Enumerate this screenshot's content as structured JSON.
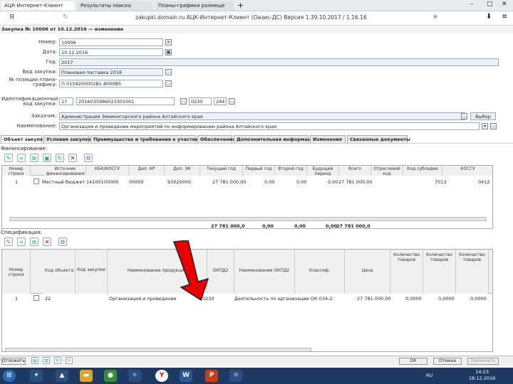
{
  "browser": {
    "tabs": [
      {
        "label": "АЦК-Интернет-Клиент"
      },
      {
        "label": "Результаты поиска"
      },
      {
        "label": "Планы-графики размеще"
      }
    ],
    "logo": "Я",
    "address": "zakupki.domain.ru  АЦК-Интернет-Клиент (Оазис-ДС) Версия 1.39.10.2017 / 1.16.16",
    "newtab": "+"
  },
  "page": {
    "header": "Закупка № 10006 от 10.12.2016 — изменение"
  },
  "form": {
    "number_label": "Номер:",
    "number": "10006",
    "date_label": "Дата:",
    "date": "10.12.2016",
    "year_label": "Год:",
    "year": "2017",
    "plan_label": "Вид закупки:",
    "plan": "Плановая поставка 2018",
    "pos_label": "№ позиции плана-графика:",
    "pos": "П.0159200002В1.8000В5",
    "ident_label": "Идентификационный код закупки:",
    "ident_a": "17",
    "ident_b": "2016035986023301001",
    "ident_c": "0230",
    "ident_d": "244",
    "customer_label": "Заказчик:",
    "customer": "Администрация Змеиногорского района Алтайского края",
    "choose": "Выбор",
    "name_label": "Наименование:",
    "name": "Организация и проведение мероприятий по информированию района Алтайского края"
  },
  "tabs": [
    "Объект закупки",
    "Условия закупки",
    "Преимущества и требования к участнику",
    "Обеспечение",
    "Дополнительная информация",
    "Изменения",
    "Связанные документы"
  ],
  "finance": {
    "title": "Финансирование:",
    "cols": [
      "Номер строки",
      "Источник финансирования",
      "КБК/КОСГУ",
      "Доп. КР",
      "Доп. ЭК",
      "Текущий год",
      "Первый год",
      "Второй год",
      "Будущий период",
      "Всего",
      "Отраслевой код",
      "Код субсидии",
      "КОСГУ"
    ],
    "rows": [
      {
        "n": "1",
        "src": "Местный бюджет",
        "kbk": "14100100000",
        "dkr": "00000",
        "dek": "93020000",
        "cur": "27 781 000,00",
        "y1": "0,00",
        "y2": "0,00",
        "fut": "0,00",
        "tot": "27 781 000,00",
        "code": "7013",
        "kosgu": "0412"
      }
    ],
    "totals": {
      "cur": "27 781 000,0",
      "y1": "0,00",
      "y2": "0,00",
      "fut": "0,00",
      "tot": "27 781 000,0"
    }
  },
  "spec": {
    "title": "Спецификация:",
    "cols": [
      "Номер строки",
      "",
      "Код объекта",
      "Код закупки",
      "Наименование продукции",
      "",
      "ОКПД2",
      "Наименование ОКПД2",
      "Классиф.",
      "Цена",
      "Количество товаров",
      "Количество товаров",
      "Количество товаров"
    ],
    "rows": [
      {
        "n": "1",
        "code": "22",
        "name": "Организация и проведение",
        "okpd": "0230",
        "okpdname": "Деятельность по организации ОК 034-2",
        "price": "27 781 000,00",
        "q1": "0,0000",
        "q2": "0,0000",
        "q3": "0,0000"
      }
    ]
  },
  "bottom": {
    "search": "Отложить",
    "ok": "ОК",
    "cancel": "Отмена",
    "apply": "Применить"
  },
  "taskbar": {
    "lang": "RU",
    "time": "14:23",
    "date": "18.12.2016"
  },
  "colors": {
    "accent": "#1e3a64",
    "arrow": "#e60000"
  }
}
